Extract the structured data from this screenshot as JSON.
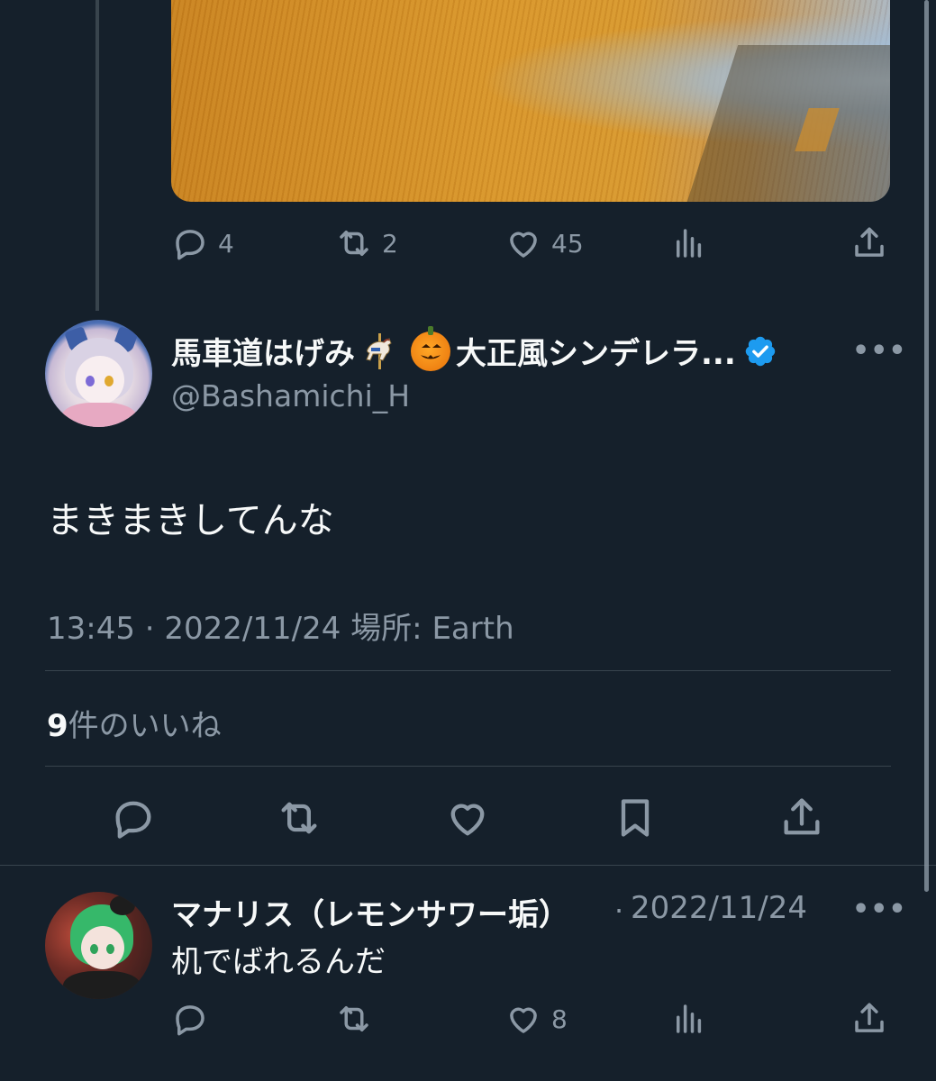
{
  "prev_tweet": {
    "actions": {
      "reply_count": "4",
      "retweet_count": "2",
      "like_count": "45"
    },
    "icons": [
      "reply-icon",
      "retweet-icon",
      "like-icon",
      "views-icon",
      "share-icon"
    ]
  },
  "main_tweet": {
    "display_name": "馬車道はげみ",
    "name_suffix": "大正風シンデレラ...",
    "handle": "@Bashamichi_H",
    "more": "•••",
    "text": "まきまきしてんな",
    "meta": "13:45 · 2022/11/24 場所: Earth",
    "likes_count": "9",
    "likes_label": "件のいいね",
    "icons": [
      "reply-icon",
      "retweet-icon",
      "like-icon",
      "bookmark-icon",
      "share-icon"
    ]
  },
  "reply": {
    "display_name": "マナリス（レモンサワー垢）",
    "separator": "·",
    "date": "2022/11/24",
    "more": "•••",
    "text": "机でばれるんだ",
    "like_count": "8"
  },
  "colors": {
    "background": "#15202b",
    "text": "#f7f9f9",
    "muted": "#8b98a5",
    "divider": "#38444d",
    "verified": "#1d9bf0"
  }
}
